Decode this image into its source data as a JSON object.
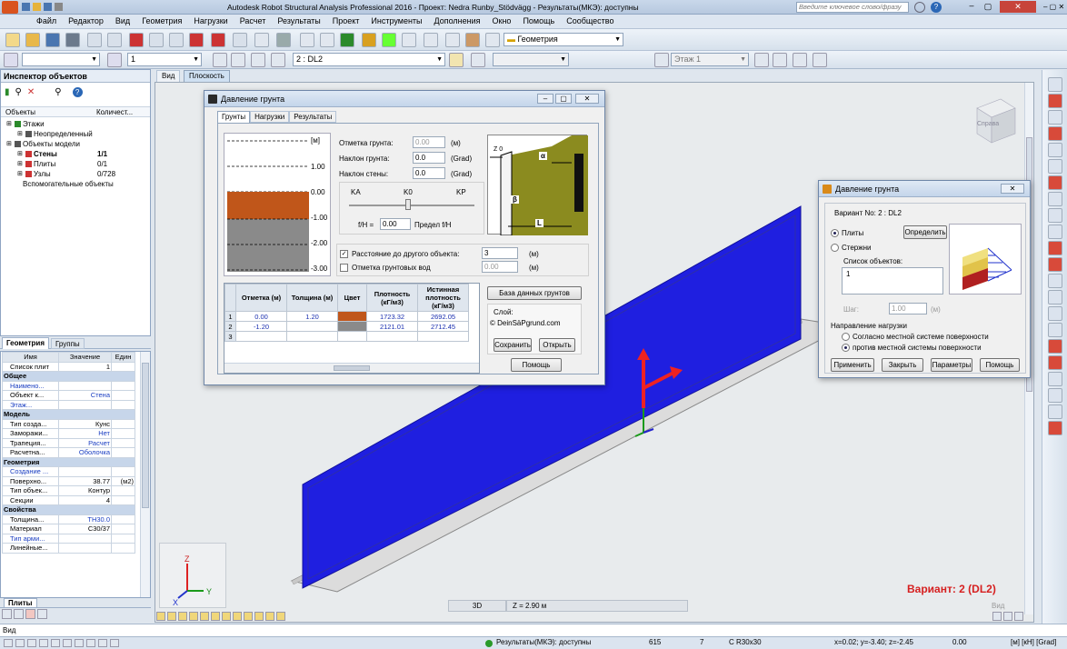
{
  "app": {
    "title": "Autodesk Robot Structural Analysis Professional 2016 - Проект: Nedra Runby_Stödvägg - Результаты(МКЭ): доступны",
    "search_placeholder": "Введите ключевое слово/фразу"
  },
  "menu": [
    "Файл",
    "Редактор",
    "Вид",
    "Геометрия",
    "Нагрузки",
    "Расчет",
    "Результаты",
    "Проект",
    "Инструменты",
    "Дополнения",
    "Окно",
    "Помощь",
    "Сообщество"
  ],
  "toolbar": {
    "layout_combo": "Геометрия",
    "case_number": "1",
    "case_combo": "2 : DL2",
    "storey_combo": "Этаж 1"
  },
  "inspector": {
    "title": "Инспектор объектов",
    "col_objects": "Объекты",
    "col_count": "Количест...",
    "tree": [
      {
        "label": "Этажи",
        "count": ""
      },
      {
        "label": "Неопределенный",
        "count": ""
      },
      {
        "label": "Объекты модели",
        "count": ""
      },
      {
        "label": "Стены",
        "count": "1/1"
      },
      {
        "label": "Плиты",
        "count": "0/1"
      },
      {
        "label": "Узлы",
        "count": "0/728"
      },
      {
        "label": "Вспомогательные объекты",
        "count": ""
      }
    ],
    "tabs": [
      "Геометрия",
      "Группы"
    ]
  },
  "props": {
    "headers": [
      "Имя",
      "Значение",
      "Един"
    ],
    "rows": [
      {
        "n": "Список плит",
        "v": "1",
        "u": "",
        "t": "row"
      },
      {
        "n": "Общее",
        "t": "sec"
      },
      {
        "n": "Наимено...",
        "v": "",
        "u": "",
        "t": "blue"
      },
      {
        "n": "Объект к...",
        "v": "Стена",
        "u": "",
        "t": "bluev"
      },
      {
        "n": "Этаж...",
        "v": "",
        "u": "",
        "t": "blue"
      },
      {
        "n": "Модель",
        "t": "sec"
      },
      {
        "n": "Тип созда...",
        "v": "Кунс",
        "u": "",
        "t": "row"
      },
      {
        "n": "Заморажи...",
        "v": "Нет",
        "u": "",
        "t": "bluev"
      },
      {
        "n": "Трапеция...",
        "v": "Расчет",
        "u": "",
        "t": "bluev"
      },
      {
        "n": "Расчетна...",
        "v": "Оболочка",
        "u": "",
        "t": "bluev"
      },
      {
        "n": "Геометрия",
        "t": "sec"
      },
      {
        "n": "Создание ...",
        "v": "",
        "u": "",
        "t": "blue"
      },
      {
        "n": "Поверхно...",
        "v": "38.77",
        "u": "(м2)",
        "t": "row"
      },
      {
        "n": "Тип объек...",
        "v": "Контур",
        "u": "",
        "t": "row"
      },
      {
        "n": "Секции",
        "v": "4",
        "u": "",
        "t": "row"
      },
      {
        "n": "Свойства",
        "t": "sec"
      },
      {
        "n": "Толщина...",
        "v": "TH30.0",
        "u": "",
        "t": "bluev"
      },
      {
        "n": "Материал",
        "v": "C30/37",
        "u": "",
        "t": "row"
      },
      {
        "n": "Тип арми...",
        "v": "",
        "u": "",
        "t": "blue"
      },
      {
        "n": "Линейные...",
        "v": "",
        "u": "",
        "t": "row"
      }
    ],
    "bottom_tab": "Плиты"
  },
  "viewtabs": [
    "Вид",
    "Плоскость"
  ],
  "soil_dialog": {
    "title": "Давление грунта",
    "tabs": [
      "Грунты",
      "Нагрузки",
      "Результаты"
    ],
    "scale": [
      "[м]",
      "1.00",
      "0.00",
      "-1.00",
      "-2.00",
      "-3.00"
    ],
    "ground_level_label": "Отметка грунта:",
    "ground_level": "0.00",
    "unit_m": "(м)",
    "slope_label": "Наклон грунта:",
    "slope": "0.0",
    "unit_grad": "(Grad)",
    "wall_slope_label": "Наклон стены:",
    "wall_slope": "0.0",
    "ka": "KA",
    "k0": "K0",
    "kp": "KP",
    "fh_label": "f/H =",
    "fh": "0.00",
    "limit_label": "Предел f/H",
    "dist_label": "Расстояние до другого объекта:",
    "dist": "3",
    "dist_unit": "(м)",
    "gw_label": "Отметка грунтовых вод",
    "gw": "0.00",
    "gw_unit": "(м)",
    "diagram": {
      "z0": "Z 0",
      "alpha": "α",
      "beta": "β",
      "l": "L"
    },
    "table_headers": [
      "",
      "Отметка (м)",
      "Толщина (м)",
      "Цвет",
      "Плотность (кГ/м3)",
      "Истинная плотность (кГ/м3)"
    ],
    "table_rows": [
      {
        "n": "1",
        "elev": "0.00",
        "thick": "1.20",
        "color": "#c0561a",
        "dens": "1723.32",
        "true": "2692.05"
      },
      {
        "n": "2",
        "elev": "-1.20",
        "thick": "",
        "color": "#8a8a8a",
        "dens": "2121.01",
        "true": "2712.45"
      },
      {
        "n": "3",
        "elev": "",
        "thick": "",
        "color": "",
        "dens": "",
        "true": ""
      }
    ],
    "db_button": "База данных грунтов",
    "layer_label": "Слой:",
    "layer_value": "© DeinSäPgrund.com",
    "save": "Сохранить",
    "open": "Открыть",
    "help": "Помощь"
  },
  "load_dialog": {
    "title": "Давление грунта",
    "variant": "Вариант No: 2 : DL2",
    "plates": "Плиты",
    "bars": "Стержни",
    "define": "Определить",
    "list_label": "Список объектов:",
    "list_value": "1",
    "step_label": "Шаг:",
    "step": "1.00",
    "step_unit": "(м)",
    "dir_label": "Направление нагрузки",
    "dir1": "Согласно местной системе поверхности",
    "dir2": "против местной системы поверхности",
    "apply": "Применить",
    "close": "Закрыть",
    "params": "Параметры",
    "help": "Помощь"
  },
  "viewport": {
    "variant_label": "Вариант: 2 (DL2)",
    "cube_label": "Справа",
    "view_mode": "3D",
    "z_level": "Z = 2.90 м",
    "vid": "Вид"
  },
  "status": {
    "left": "Вид",
    "results": "Результаты(МКЭ): доступны",
    "n1": "615",
    "n2": "7",
    "section": "C R30x30",
    "coords": "x=0.02; y=-3.40; z=-2.45",
    "coordval": "0.00",
    "units": "[м] [кН] [Grad]"
  },
  "colors": {
    "wall": "#1f1fe0",
    "soil_brown": "#c0561a",
    "soil_gray": "#8a8a8a",
    "diagram_bg": "#8b8b1f",
    "variant_red": "#d62020"
  }
}
